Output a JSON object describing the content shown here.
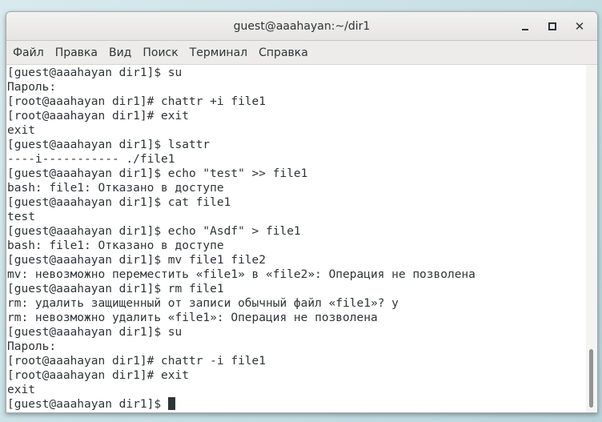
{
  "window": {
    "title": "guest@aaahayan:~/dir1"
  },
  "menu": {
    "items": [
      "Файл",
      "Правка",
      "Вид",
      "Поиск",
      "Терминал",
      "Справка"
    ]
  },
  "terminal": {
    "lines": [
      "[guest@aaahayan dir1]$ su",
      "Пароль:",
      "[root@aaahayan dir1]# chattr +i file1",
      "[root@aaahayan dir1]# exit",
      "exit",
      "[guest@aaahayan dir1]$ lsattr",
      "----i----------- ./file1",
      "[guest@aaahayan dir1]$ echo \"test\" >> file1",
      "bash: file1: Отказано в доступе",
      "[guest@aaahayan dir1]$ cat file1",
      "test",
      "[guest@aaahayan dir1]$ echo \"Asdf\" > file1",
      "bash: file1: Отказано в доступе",
      "[guest@aaahayan dir1]$ mv file1 file2",
      "mv: невозможно переместить «file1» в «file2»: Операция не позволена",
      "[guest@aaahayan dir1]$ rm file1",
      "rm: удалить защищенный от записи обычный файл «file1»? y",
      "rm: невозможно удалить «file1»: Операция не позволена",
      "[guest@aaahayan dir1]$ su",
      "Пароль:",
      "[root@aaahayan dir1]# chattr -i file1",
      "[root@aaahayan dir1]# exit",
      "exit"
    ],
    "prompt": "[guest@aaahayan dir1]$ "
  },
  "icons": {
    "minimize": "minimize-icon",
    "maximize": "maximize-icon",
    "close": "close-icon"
  },
  "colors": {
    "text": "#2e3436",
    "background": "#ffffff",
    "titlebar": "#e8e7e5"
  }
}
